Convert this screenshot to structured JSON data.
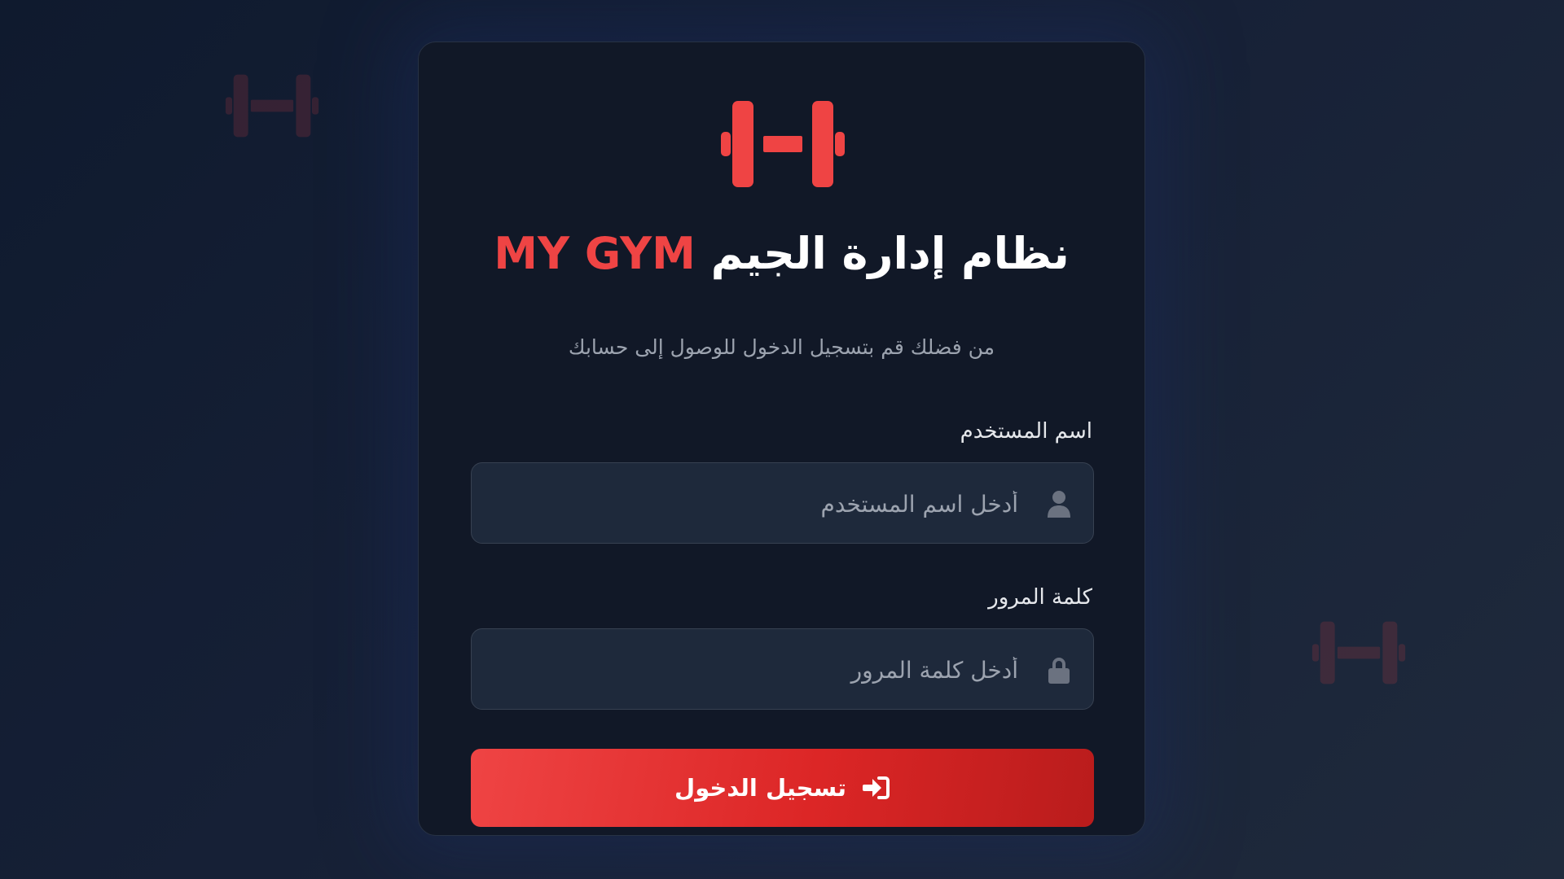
{
  "login": {
    "title_brand": "MY GYM",
    "title_text": "نظام إدارة الجيم",
    "subtitle": "من فضلك قم بتسجيل الدخول للوصول إلى حسابك",
    "username": {
      "label": "اسم المستخدم",
      "placeholder": "أدخل اسم المستخدم",
      "value": "",
      "icon": "user-icon"
    },
    "password": {
      "label": "كلمة المرور",
      "placeholder": "أدخل كلمة المرور",
      "value": "",
      "icon": "lock-icon"
    },
    "submit_label": "تسجيل الدخول",
    "submit_icon": "sign-in-icon",
    "logo_icon": "dumbbell-icon"
  },
  "colors": {
    "accent": "#ef4444",
    "accent_dark": "#b91c1c",
    "card_bg": "#111827",
    "input_bg": "#1e293b",
    "page_bg": "#0f1a2e"
  }
}
